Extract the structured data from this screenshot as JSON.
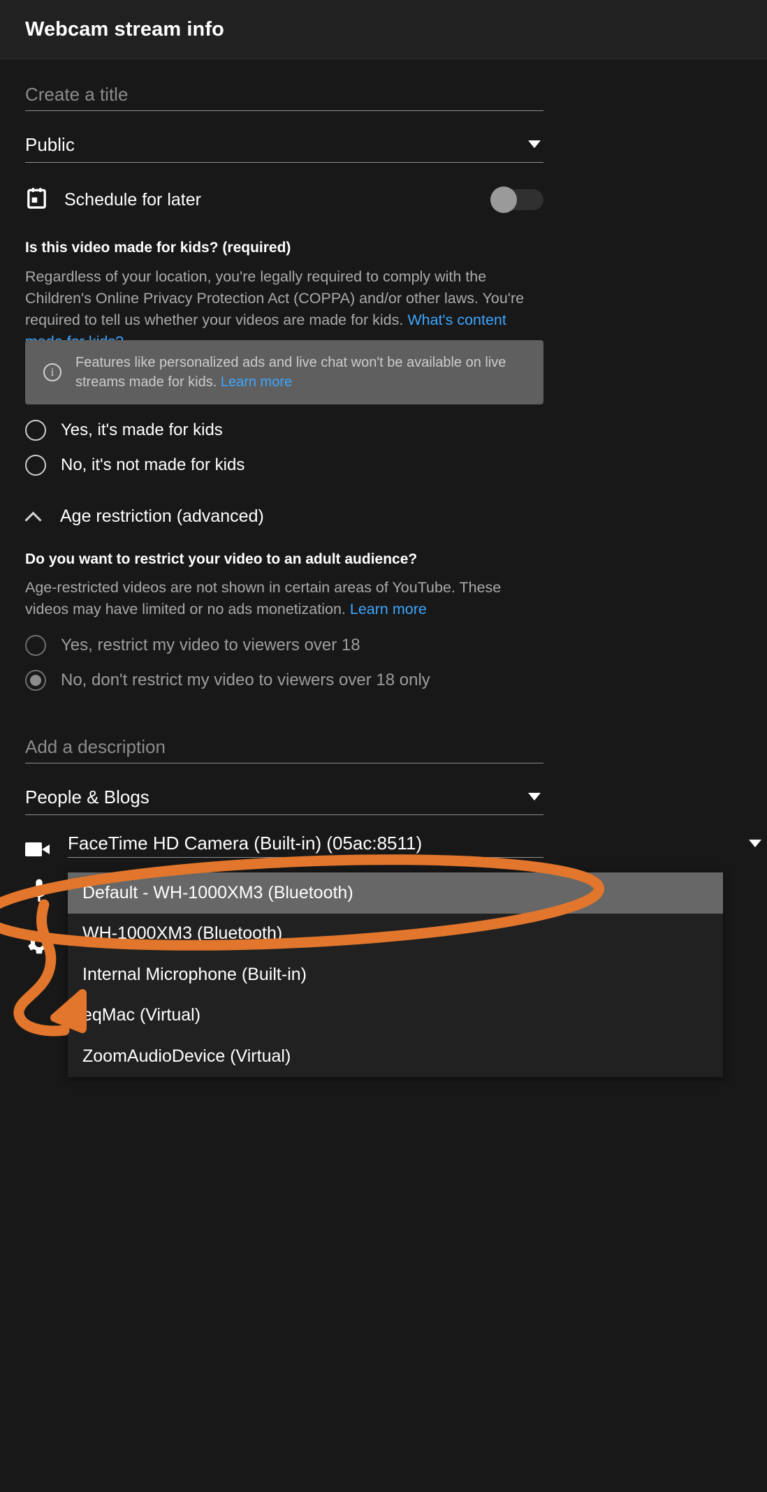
{
  "header": {
    "title": "Webcam stream info"
  },
  "form": {
    "title_placeholder": "Create a title",
    "privacy_value": "Public",
    "schedule_label": "Schedule for later",
    "schedule_toggle_state": "off",
    "kids_heading": "Is this video made for kids? (required)",
    "kids_desc_part1": "Regardless of your location, you're legally required to comply with the Children's Online Privacy Protection Act (COPPA) and/or other laws. You're required to tell us whether your videos are made for kids. ",
    "kids_desc_link": "What's content made for kids?",
    "kids_banner_text": "Features like personalized ads and live chat won't be available on live streams made for kids. ",
    "kids_banner_link": "Learn more",
    "kids_radio_yes": "Yes, it's made for kids",
    "kids_radio_no": "No, it's not made for kids",
    "age_section_label": "Age restriction (advanced)",
    "age_question": "Do you want to restrict your video to an adult audience?",
    "age_desc_part1": "Age-restricted videos are not shown in certain areas of YouTube. These videos may have limited or no ads monetization. ",
    "age_desc_link": "Learn more",
    "age_radio_yes": "Yes, restrict my video to viewers over 18",
    "age_radio_no": "No, don't restrict my video to viewers over 18 only",
    "age_selected": "no",
    "description_placeholder": "Add a description",
    "category_value": "People & Blogs",
    "camera_value": "FaceTime HD Camera (Built-in) (05ac:8511)"
  },
  "audio_dropdown": {
    "items": [
      {
        "label": "Default - WH-1000XM3 (Bluetooth)",
        "selected": true
      },
      {
        "label": "WH-1000XM3 (Bluetooth)",
        "selected": false
      },
      {
        "label": "Internal Microphone (Built-in)",
        "selected": false
      },
      {
        "label": "eqMac (Virtual)",
        "selected": false
      },
      {
        "label": "ZoomAudioDevice (Virtual)",
        "selected": false
      }
    ]
  },
  "colors": {
    "background": "#181818",
    "header_background": "#212121",
    "link": "#3ea6ff",
    "banner_background": "#5f5f5f",
    "dropdown_background": "#212121",
    "dropdown_selected": "#676767",
    "annotation": "#e2762c"
  },
  "icons": {
    "calendar": "calendar-icon",
    "info": "info-icon",
    "chevron_up": "chevron-up-icon",
    "camera": "video-camera-icon",
    "microphone": "microphone-icon",
    "gear": "gear-icon"
  }
}
